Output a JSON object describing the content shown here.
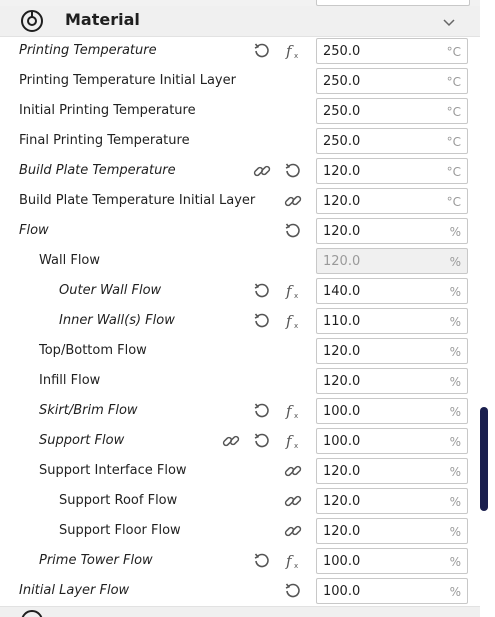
{
  "section": {
    "title": "Material",
    "icon": "material-spool-icon",
    "collapse_icon": "chevron-down-icon"
  },
  "settings": [
    {
      "id": "printing-temperature",
      "label": "Printing Temperature",
      "italic": true,
      "indent": 0,
      "icons": [
        "reset-icon",
        "function-icon"
      ],
      "value": "250.0",
      "unit": "°C",
      "disabled": false
    },
    {
      "id": "printing-temperature-initial-layer",
      "label": "Printing Temperature Initial Layer",
      "italic": false,
      "indent": 0,
      "icons": [],
      "value": "250.0",
      "unit": "°C",
      "disabled": false
    },
    {
      "id": "initial-printing-temperature",
      "label": "Initial Printing Temperature",
      "italic": false,
      "indent": 0,
      "icons": [],
      "value": "250.0",
      "unit": "°C",
      "disabled": false
    },
    {
      "id": "final-printing-temperature",
      "label": "Final Printing Temperature",
      "italic": false,
      "indent": 0,
      "icons": [],
      "value": "250.0",
      "unit": "°C",
      "disabled": false
    },
    {
      "id": "build-plate-temperature",
      "label": "Build Plate Temperature",
      "italic": true,
      "indent": 0,
      "icons": [
        "link-icon",
        "reset-icon"
      ],
      "value": "120.0",
      "unit": "°C",
      "disabled": false
    },
    {
      "id": "build-plate-temperature-initial-layer",
      "label": "Build Plate Temperature Initial Layer",
      "italic": false,
      "indent": 0,
      "icons": [
        "link-icon"
      ],
      "value": "120.0",
      "unit": "°C",
      "disabled": false
    },
    {
      "id": "flow",
      "label": "Flow",
      "italic": true,
      "indent": 0,
      "icons": [
        "reset-icon"
      ],
      "value": "120.0",
      "unit": "%",
      "disabled": false
    },
    {
      "id": "wall-flow",
      "label": "Wall Flow",
      "italic": false,
      "indent": 1,
      "icons": [],
      "value": "120.0",
      "unit": "%",
      "disabled": true
    },
    {
      "id": "outer-wall-flow",
      "label": "Outer Wall Flow",
      "italic": true,
      "indent": 2,
      "icons": [
        "reset-icon",
        "function-icon"
      ],
      "value": "140.0",
      "unit": "%",
      "disabled": false
    },
    {
      "id": "inner-walls-flow",
      "label": "Inner Wall(s) Flow",
      "italic": true,
      "indent": 2,
      "icons": [
        "reset-icon",
        "function-icon"
      ],
      "value": "110.0",
      "unit": "%",
      "disabled": false
    },
    {
      "id": "top-bottom-flow",
      "label": "Top/Bottom Flow",
      "italic": false,
      "indent": 1,
      "icons": [],
      "value": "120.0",
      "unit": "%",
      "disabled": false
    },
    {
      "id": "infill-flow",
      "label": "Infill Flow",
      "italic": false,
      "indent": 1,
      "icons": [],
      "value": "120.0",
      "unit": "%",
      "disabled": false
    },
    {
      "id": "skirt-brim-flow",
      "label": "Skirt/Brim Flow",
      "italic": true,
      "indent": 1,
      "icons": [
        "reset-icon",
        "function-icon"
      ],
      "value": "100.0",
      "unit": "%",
      "disabled": false
    },
    {
      "id": "support-flow",
      "label": "Support Flow",
      "italic": true,
      "indent": 1,
      "icons": [
        "link-icon",
        "reset-icon",
        "function-icon"
      ],
      "value": "100.0",
      "unit": "%",
      "disabled": false
    },
    {
      "id": "support-interface-flow",
      "label": "Support Interface Flow",
      "italic": false,
      "indent": 1,
      "icons": [
        "link-icon"
      ],
      "value": "120.0",
      "unit": "%",
      "disabled": false
    },
    {
      "id": "support-roof-flow",
      "label": "Support Roof Flow",
      "italic": false,
      "indent": 2,
      "icons": [
        "link-icon"
      ],
      "value": "120.0",
      "unit": "%",
      "disabled": false
    },
    {
      "id": "support-floor-flow",
      "label": "Support Floor Flow",
      "italic": false,
      "indent": 2,
      "icons": [
        "link-icon"
      ],
      "value": "120.0",
      "unit": "%",
      "disabled": false
    },
    {
      "id": "prime-tower-flow",
      "label": "Prime Tower Flow",
      "italic": true,
      "indent": 1,
      "icons": [
        "reset-icon",
        "function-icon"
      ],
      "value": "100.0",
      "unit": "%",
      "disabled": false
    },
    {
      "id": "initial-layer-flow",
      "label": "Initial Layer Flow",
      "italic": true,
      "indent": 0,
      "icons": [
        "reset-icon"
      ],
      "value": "100.0",
      "unit": "%",
      "disabled": false
    }
  ],
  "next_section": {
    "icon": "speed-icon"
  },
  "colors": {
    "accent": "#1a1f4e",
    "icon": "#555555",
    "disabled_value": "#9a9a9a"
  }
}
